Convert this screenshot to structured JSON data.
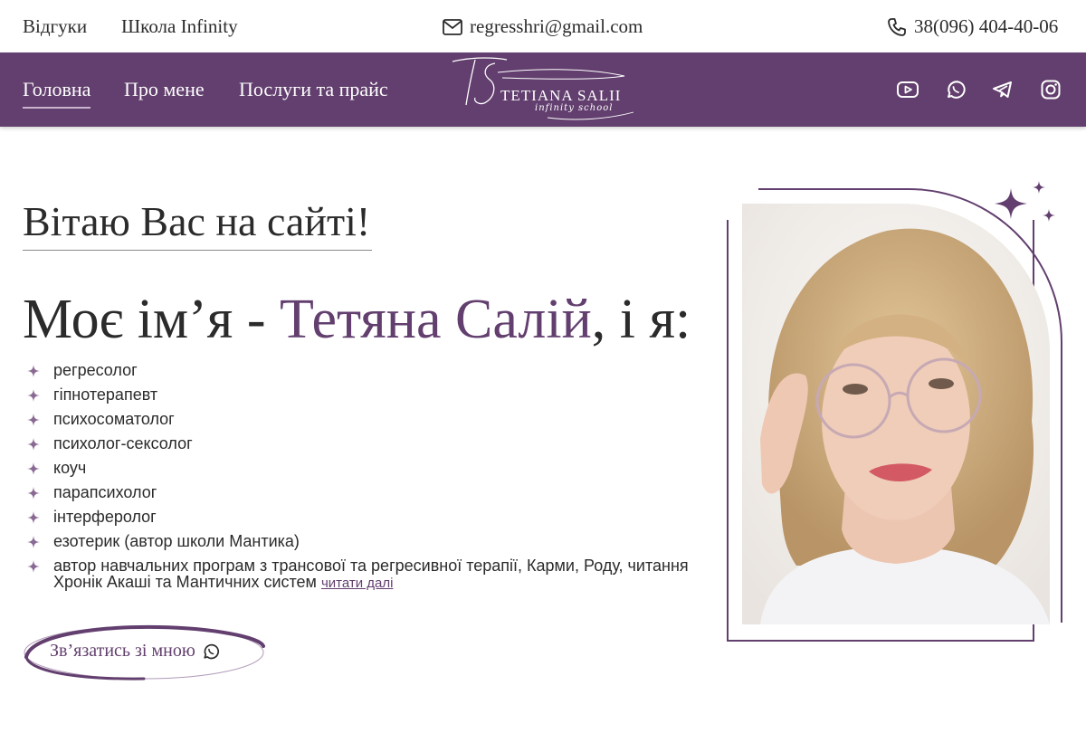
{
  "topbar": {
    "links": [
      "Відгуки",
      "Школа Infinity"
    ],
    "email": "regresshri@gmail.com",
    "phone": "38(096) 404-40-06"
  },
  "nav": {
    "items": [
      {
        "label": "Головна",
        "active": true
      },
      {
        "label": "Про мене",
        "active": false
      },
      {
        "label": "Послуги та прайс",
        "active": false
      }
    ],
    "logo_monogram": "TS",
    "logo_name": "TETIANA SALII",
    "logo_sub": "infinity school",
    "social_icons": [
      "youtube-icon",
      "whatsapp-icon",
      "telegram-icon",
      "instagram-icon"
    ]
  },
  "hero": {
    "welcome": "Вітаю Вас на сайті!",
    "intro_prefix": "Моє ім’я - ",
    "intro_name": "Тетяна Салій",
    "intro_suffix": ", і я:",
    "roles": [
      "регресолог",
      "гіпнотерапевт",
      "психосоматолог",
      "психолог-сексолог",
      "коуч",
      "парапсихолог",
      "інтерферолог",
      "езотерик (автор школи Мантика)",
      "автор навчальних програм з трансової та регресивної терапії, Карми, Роду,  читання Хронік Акаші та Мантичних систем"
    ],
    "read_more": "читати далі",
    "cta_label": "Зв’язатись зі мною"
  },
  "colors": {
    "accent": "#623f6e",
    "text": "#2b2b2b",
    "background": "#ffffff"
  }
}
